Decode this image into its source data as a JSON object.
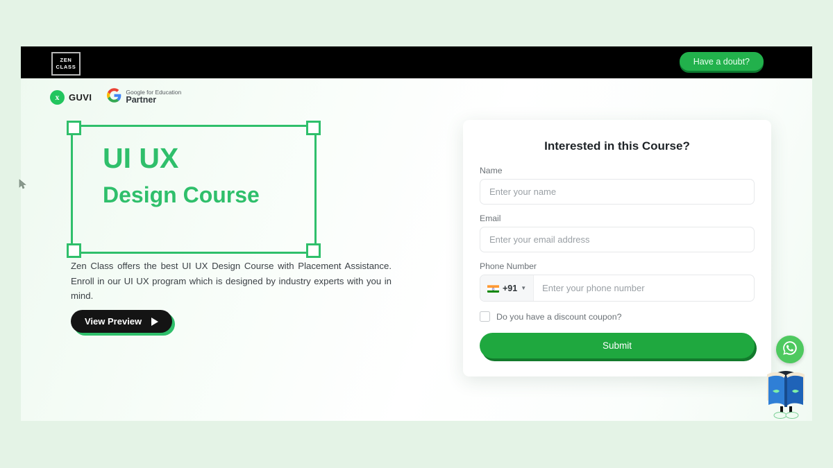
{
  "colors": {
    "brand_green": "#2fbf6b",
    "nav_black": "#000000",
    "button_green": "#22b14c",
    "submit_green": "#1fa83f",
    "page_background": "#e4f3e6",
    "whatsapp_green": "#4ec95f"
  },
  "nav": {
    "logo_line1": "ZEN",
    "logo_line2": "CLASS",
    "doubt_button": "Have a doubt?"
  },
  "hero": {
    "badges": {
      "guvi_label": "GUVI",
      "google_top": "Google for Education",
      "google_bottom": "Partner",
      "google_mark": "G"
    },
    "title_line1": "UI UX",
    "title_line2": "Design Course",
    "blurb": "Zen Class offers the best UI UX Design Course with Placement Assistance. Enroll in our UI UX program which is designed by industry experts with you in mind.",
    "preview_button": "View Preview"
  },
  "form": {
    "title": "Interested in this Course?",
    "name": {
      "label": "Name",
      "placeholder": "Enter your name",
      "value": ""
    },
    "email": {
      "label": "Email",
      "placeholder": "Enter your email address",
      "value": ""
    },
    "phone": {
      "label": "Phone Number",
      "country_code": "+91",
      "country_flag": "india-flag",
      "placeholder": "Enter your phone number",
      "value": ""
    },
    "coupon": {
      "label": "Do you have a discount coupon?",
      "checked": false
    },
    "submit_label": "Submit"
  },
  "widgets": {
    "whatsapp": "whatsapp-icon",
    "mascot": "book-mascot"
  }
}
